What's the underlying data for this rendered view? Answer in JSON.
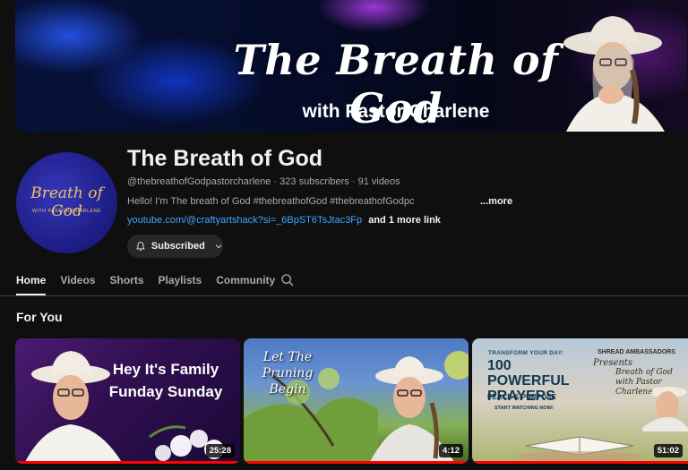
{
  "banner": {
    "title": "The Breath of God",
    "subtitle": "with Pastor Charlene"
  },
  "avatar": {
    "logo_text": "Breath of God",
    "logo_sub": "WITH PASTOR CHARLENE"
  },
  "channel": {
    "title": "The Breath of God",
    "meta": "@thebreathofGodpastorcharlene · 323 subscribers · 91 videos",
    "description": "Hello! I'm The breath of God #thebreathofGod #thebreathofGodpc",
    "more_label": "...more",
    "external_link": "youtube.com/@craftyartshack?si=_6BpST6TsJtac3Fp",
    "more_links_label": "and 1 more link",
    "subscribe_label": "Subscribed"
  },
  "tabs": [
    {
      "label": "Home",
      "active": true
    },
    {
      "label": "Videos",
      "active": false
    },
    {
      "label": "Shorts",
      "active": false
    },
    {
      "label": "Playlists",
      "active": false
    },
    {
      "label": "Community",
      "active": false
    }
  ],
  "section_title": "For You",
  "videos": [
    {
      "thumb_text": "Hey It's Family Funday Sunday",
      "duration": "25:28",
      "watched_fraction": 1.0
    },
    {
      "thumb_text": "Let The Pruning Begin",
      "duration": "4:12",
      "watched_fraction": 1.0
    },
    {
      "thumb_top": "TRANSFORM YOUR DAY:",
      "thumb_big": "100 POWERFUL PRAYERS",
      "thumb_peace": "PEACE & PURPOSE",
      "thumb_start": "START WATCHING NOW!",
      "thumb_shread": "SHREAD AMBASSADORS",
      "thumb_presents": "Presents",
      "thumb_bog": "Breath of God with Pastor Charlene",
      "duration": "51:02",
      "watched_fraction": 1.0
    }
  ],
  "colors": {
    "background": "#0f0f0f",
    "link": "#3ea6ff",
    "progress": "#ff0000",
    "secondary_text": "#aaaaaa"
  }
}
